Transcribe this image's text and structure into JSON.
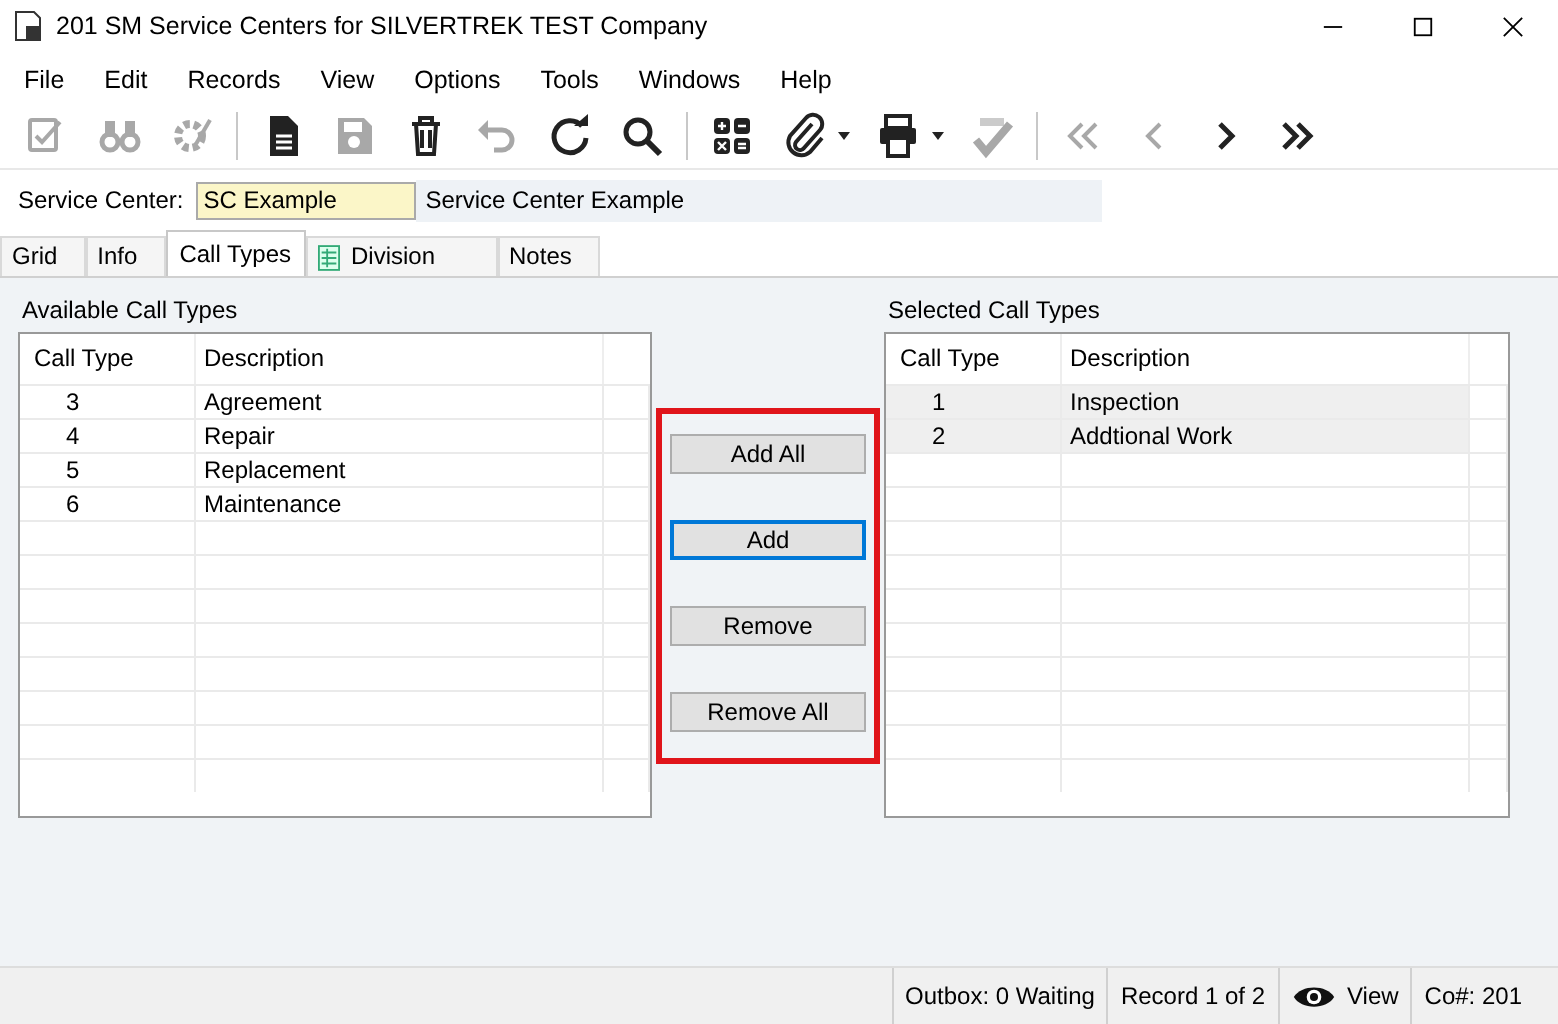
{
  "window": {
    "title": "201 SM Service Centers for SILVERTREK TEST Company"
  },
  "menu": [
    "File",
    "Edit",
    "Records",
    "View",
    "Options",
    "Tools",
    "Windows",
    "Help"
  ],
  "toolbar": [
    {
      "kind": "checklist",
      "disabled": true,
      "dropdown": false
    },
    {
      "kind": "binoculars",
      "disabled": true,
      "dropdown": false
    },
    {
      "kind": "gear",
      "disabled": true,
      "dropdown": false
    },
    {
      "kind": "separator"
    },
    {
      "kind": "document",
      "disabled": false,
      "dropdown": false
    },
    {
      "kind": "save",
      "disabled": true,
      "dropdown": false
    },
    {
      "kind": "trash",
      "disabled": false,
      "dropdown": false
    },
    {
      "kind": "undo",
      "disabled": true,
      "dropdown": false
    },
    {
      "kind": "refresh",
      "disabled": false,
      "dropdown": false
    },
    {
      "kind": "search",
      "disabled": false,
      "dropdown": false
    },
    {
      "kind": "separator"
    },
    {
      "kind": "calculator",
      "disabled": false,
      "dropdown": false
    },
    {
      "kind": "paperclip",
      "disabled": false,
      "dropdown": true
    },
    {
      "kind": "printer",
      "disabled": false,
      "dropdown": true
    },
    {
      "kind": "spellcheck",
      "disabled": true,
      "dropdown": false
    },
    {
      "kind": "separator"
    },
    {
      "kind": "first",
      "disabled": true,
      "dropdown": false
    },
    {
      "kind": "previous",
      "disabled": true,
      "dropdown": false
    },
    {
      "kind": "next",
      "disabled": false,
      "dropdown": false
    },
    {
      "kind": "last",
      "disabled": false,
      "dropdown": false
    }
  ],
  "service_center": {
    "label": "Service Center:",
    "value": "SC Example",
    "description": "Service Center Example"
  },
  "tabs": [
    {
      "label": "Grid",
      "selected": false,
      "icon": false
    },
    {
      "label": "Info",
      "selected": false,
      "icon": false
    },
    {
      "label": "Call Types",
      "selected": true,
      "icon": false
    },
    {
      "label": "Division",
      "selected": false,
      "icon": true
    },
    {
      "label": "Notes",
      "selected": false,
      "icon": false
    }
  ],
  "available": {
    "title": "Available Call Types",
    "columns": [
      "Call Type",
      "Description"
    ],
    "rows": [
      {
        "call_type": "3",
        "description": "Agreement",
        "selected": false
      },
      {
        "call_type": "4",
        "description": "Repair",
        "selected": false
      },
      {
        "call_type": "5",
        "description": "Replacement",
        "selected": false
      },
      {
        "call_type": "6",
        "description": "Maintenance",
        "selected": false
      }
    ]
  },
  "buttons": [
    {
      "label": "Add All",
      "focused": false
    },
    {
      "label": "Add",
      "focused": true
    },
    {
      "label": "Remove",
      "focused": false
    },
    {
      "label": "Remove All",
      "focused": false
    }
  ],
  "selected_list": {
    "title": "Selected Call Types",
    "columns": [
      "Call Type",
      "Description"
    ],
    "rows": [
      {
        "call_type": "1",
        "description": "Inspection",
        "selected": true
      },
      {
        "call_type": "2",
        "description": "Addtional Work",
        "selected": true
      }
    ]
  },
  "status_bar": {
    "outbox": "Outbox: 0 Waiting",
    "record": "Record 1 of 2",
    "mode": "View",
    "company": "Co#: 201"
  }
}
